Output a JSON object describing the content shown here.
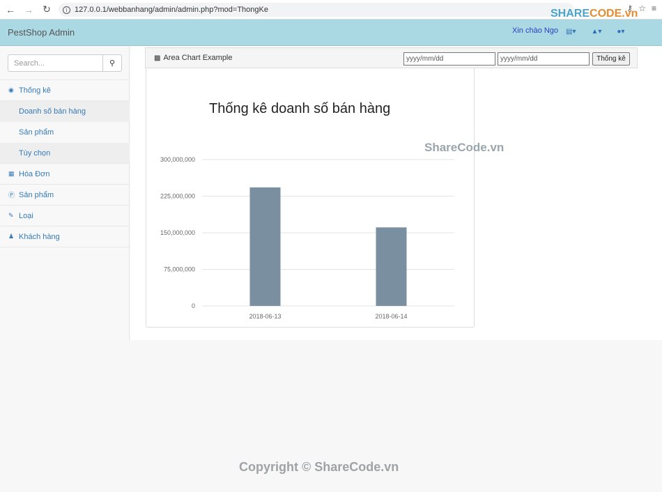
{
  "browser": {
    "url": "127.0.0.1/webbanhang/admin/admin.php?mod=ThongKe"
  },
  "navbar": {
    "brand": "PestShop Admin",
    "greeting": "Xin chào Ngo"
  },
  "sidebar": {
    "search_placeholder": "Search...",
    "items": [
      {
        "label": "Thống kê",
        "icon": "dashboard-icon"
      },
      {
        "label": "Hóa Đơn",
        "icon": "table-icon"
      },
      {
        "label": "Sản phẩm",
        "icon": "product-icon"
      },
      {
        "label": "Loại",
        "icon": "edit-icon"
      },
      {
        "label": "Khách hàng",
        "icon": "user-icon"
      }
    ],
    "subitems": [
      {
        "label": "Doanh số bán hàng"
      },
      {
        "label": "Sản phẩm"
      },
      {
        "label": "Tùy chọn"
      }
    ]
  },
  "panel": {
    "title": "Area Chart Example",
    "date_from_placeholder": "yyyy/mm/dd",
    "date_to_placeholder": "yyyy/mm/dd",
    "submit_label": "Thống kê"
  },
  "chart_data": {
    "type": "bar",
    "title": "Thống kê doanh số bán hàng",
    "categories": [
      "2018-06-13",
      "2018-06-14"
    ],
    "values": [
      243000000,
      161000000
    ],
    "yticks": [
      "0",
      "75,000,000",
      "150,000,000",
      "225,000,000",
      "300,000,000"
    ],
    "ylim": [
      0,
      300000000
    ],
    "bar_color": "#7a8fa0",
    "grid": true
  },
  "watermarks": {
    "logo_share": "SHARE",
    "logo_code": "CODE.vn",
    "middle": "ShareCode.vn",
    "footer": "Copyright © ShareCode.vn"
  }
}
